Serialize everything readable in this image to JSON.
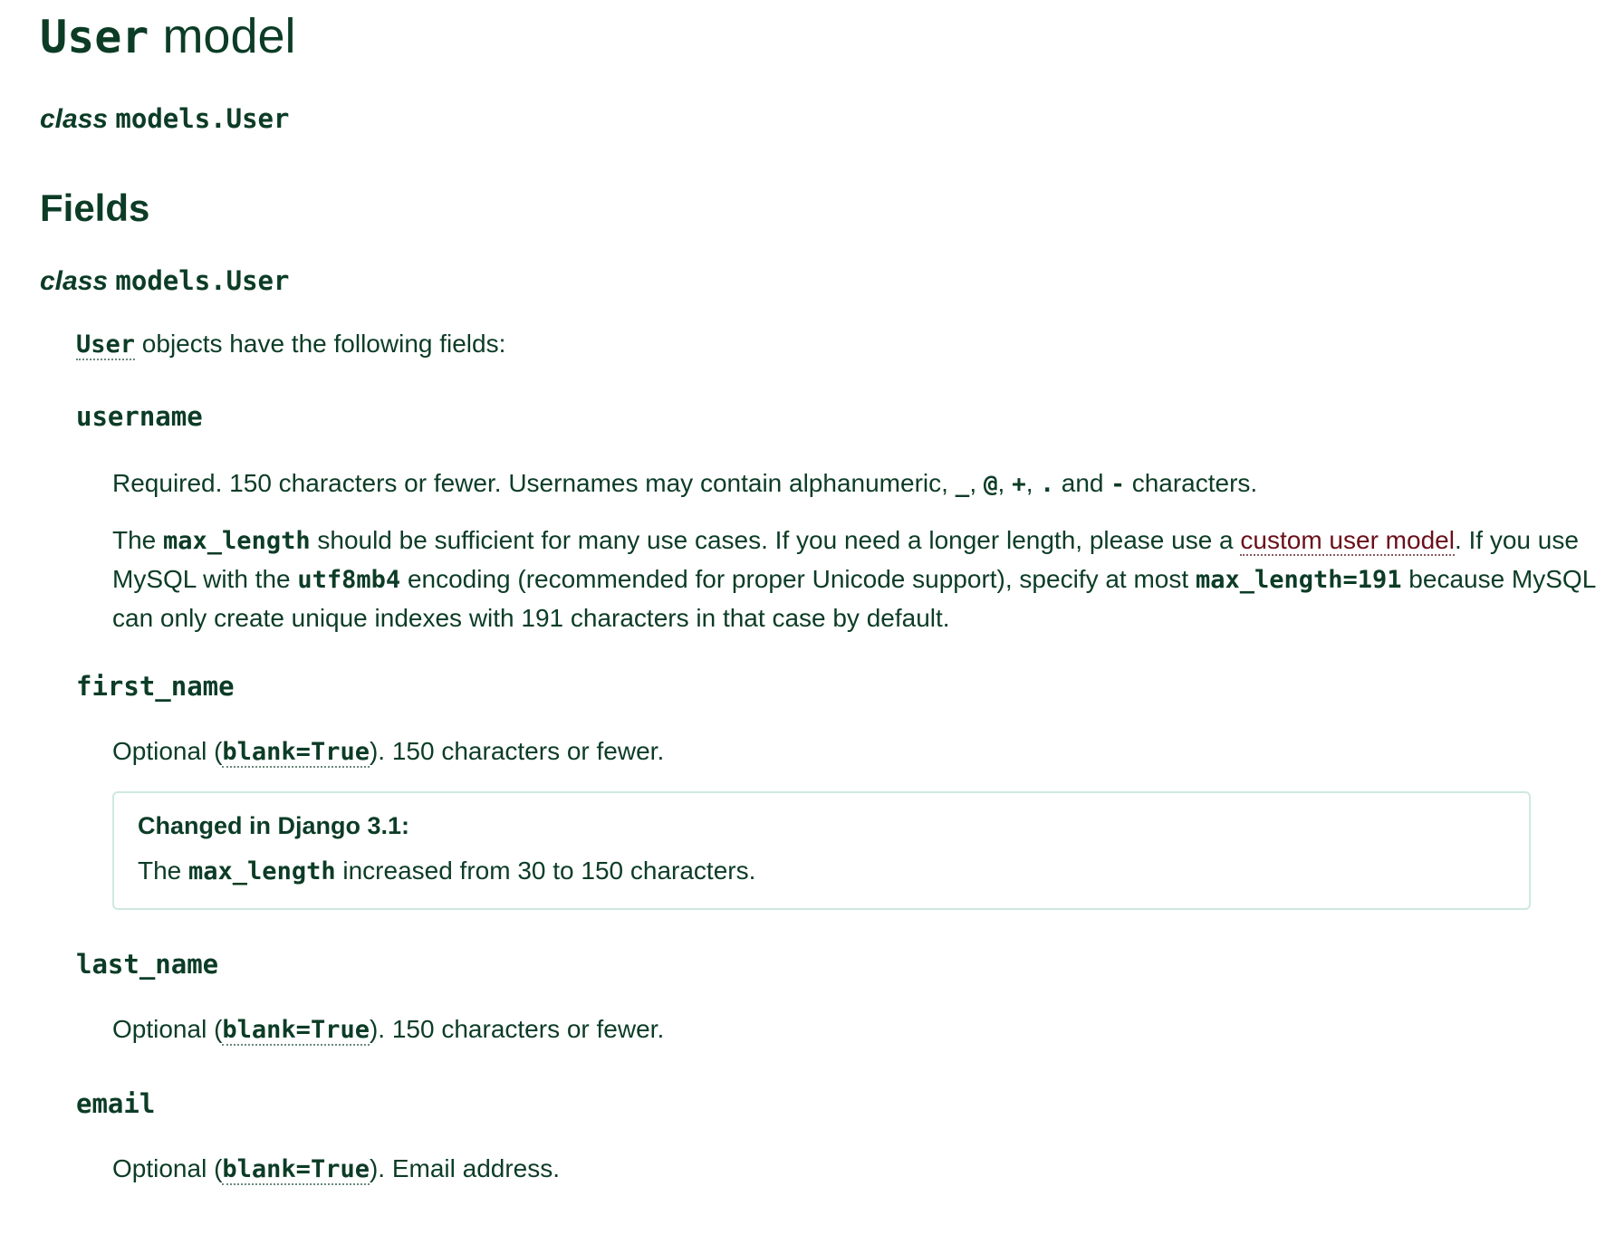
{
  "title": {
    "code": "User",
    "text": "model"
  },
  "class_decl_1": {
    "keyword": "class",
    "name": "models.User"
  },
  "fields_heading": "Fields",
  "class_decl_2": {
    "keyword": "class",
    "name": "models.User"
  },
  "intro": {
    "code": "User",
    "text": " objects have the following fields:"
  },
  "username": {
    "name": "username",
    "required": {
      "t1": "Required. 150 characters or fewer. Usernames may contain alphanumeric, ",
      "c1": "_",
      "s1": ", ",
      "c2": "@",
      "s2": ", ",
      "c3": "+",
      "s3": ", ",
      "c4": ".",
      "s4": " and ",
      "c5": "-",
      "s5": " characters."
    },
    "desc": {
      "t1": "The ",
      "c1": "max_length",
      "t2": " should be sufficient for many use cases. If you need a longer length, please use a ",
      "link": "custom user model",
      "t3": ". If you use MySQL with the ",
      "c2": "utf8mb4",
      "t4": " encoding (recommended for proper Unicode support), specify at most ",
      "c3": "max_length=191",
      "t5": " because MySQL can only create unique indexes with 191 characters in that case by default."
    }
  },
  "first_name": {
    "name": "first_name",
    "opt": {
      "t1": "Optional (",
      "code": "blank=True",
      "t2": "). 150 characters or fewer."
    },
    "note": {
      "title": "Changed in Django 3.1:",
      "t1": "The ",
      "code": "max_length",
      "t2": " increased from 30 to 150 characters."
    }
  },
  "last_name": {
    "name": "last_name",
    "opt": {
      "t1": "Optional (",
      "code": "blank=True",
      "t2": "). 150 characters or fewer."
    }
  },
  "email": {
    "name": "email",
    "opt": {
      "t1": "Optional (",
      "code": "blank=True",
      "t2": "). Email address."
    }
  },
  "colors": {
    "text": "#0c3c26",
    "link": "#6b0f1a",
    "note_border": "#cfe8e2"
  }
}
